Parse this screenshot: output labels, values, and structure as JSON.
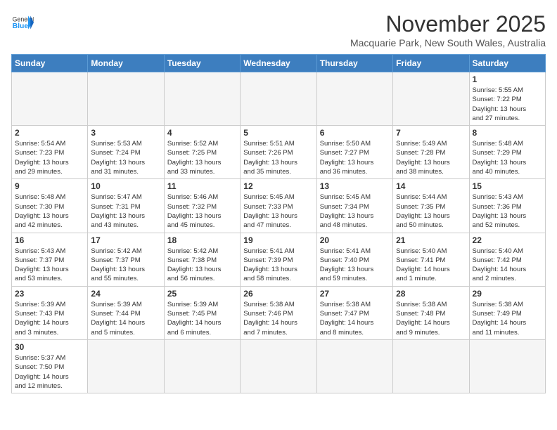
{
  "header": {
    "logo_general": "General",
    "logo_blue": "Blue",
    "month_title": "November 2025",
    "location": "Macquarie Park, New South Wales, Australia"
  },
  "days_of_week": [
    "Sunday",
    "Monday",
    "Tuesday",
    "Wednesday",
    "Thursday",
    "Friday",
    "Saturday"
  ],
  "weeks": [
    [
      {
        "day": "",
        "info": ""
      },
      {
        "day": "",
        "info": ""
      },
      {
        "day": "",
        "info": ""
      },
      {
        "day": "",
        "info": ""
      },
      {
        "day": "",
        "info": ""
      },
      {
        "day": "",
        "info": ""
      },
      {
        "day": "1",
        "info": "Sunrise: 5:55 AM\nSunset: 7:22 PM\nDaylight: 13 hours\nand 27 minutes."
      }
    ],
    [
      {
        "day": "2",
        "info": "Sunrise: 5:54 AM\nSunset: 7:23 PM\nDaylight: 13 hours\nand 29 minutes."
      },
      {
        "day": "3",
        "info": "Sunrise: 5:53 AM\nSunset: 7:24 PM\nDaylight: 13 hours\nand 31 minutes."
      },
      {
        "day": "4",
        "info": "Sunrise: 5:52 AM\nSunset: 7:25 PM\nDaylight: 13 hours\nand 33 minutes."
      },
      {
        "day": "5",
        "info": "Sunrise: 5:51 AM\nSunset: 7:26 PM\nDaylight: 13 hours\nand 35 minutes."
      },
      {
        "day": "6",
        "info": "Sunrise: 5:50 AM\nSunset: 7:27 PM\nDaylight: 13 hours\nand 36 minutes."
      },
      {
        "day": "7",
        "info": "Sunrise: 5:49 AM\nSunset: 7:28 PM\nDaylight: 13 hours\nand 38 minutes."
      },
      {
        "day": "8",
        "info": "Sunrise: 5:48 AM\nSunset: 7:29 PM\nDaylight: 13 hours\nand 40 minutes."
      }
    ],
    [
      {
        "day": "9",
        "info": "Sunrise: 5:48 AM\nSunset: 7:30 PM\nDaylight: 13 hours\nand 42 minutes."
      },
      {
        "day": "10",
        "info": "Sunrise: 5:47 AM\nSunset: 7:31 PM\nDaylight: 13 hours\nand 43 minutes."
      },
      {
        "day": "11",
        "info": "Sunrise: 5:46 AM\nSunset: 7:32 PM\nDaylight: 13 hours\nand 45 minutes."
      },
      {
        "day": "12",
        "info": "Sunrise: 5:45 AM\nSunset: 7:33 PM\nDaylight: 13 hours\nand 47 minutes."
      },
      {
        "day": "13",
        "info": "Sunrise: 5:45 AM\nSunset: 7:34 PM\nDaylight: 13 hours\nand 48 minutes."
      },
      {
        "day": "14",
        "info": "Sunrise: 5:44 AM\nSunset: 7:35 PM\nDaylight: 13 hours\nand 50 minutes."
      },
      {
        "day": "15",
        "info": "Sunrise: 5:43 AM\nSunset: 7:36 PM\nDaylight: 13 hours\nand 52 minutes."
      }
    ],
    [
      {
        "day": "16",
        "info": "Sunrise: 5:43 AM\nSunset: 7:37 PM\nDaylight: 13 hours\nand 53 minutes."
      },
      {
        "day": "17",
        "info": "Sunrise: 5:42 AM\nSunset: 7:37 PM\nDaylight: 13 hours\nand 55 minutes."
      },
      {
        "day": "18",
        "info": "Sunrise: 5:42 AM\nSunset: 7:38 PM\nDaylight: 13 hours\nand 56 minutes."
      },
      {
        "day": "19",
        "info": "Sunrise: 5:41 AM\nSunset: 7:39 PM\nDaylight: 13 hours\nand 58 minutes."
      },
      {
        "day": "20",
        "info": "Sunrise: 5:41 AM\nSunset: 7:40 PM\nDaylight: 13 hours\nand 59 minutes."
      },
      {
        "day": "21",
        "info": "Sunrise: 5:40 AM\nSunset: 7:41 PM\nDaylight: 14 hours\nand 1 minute."
      },
      {
        "day": "22",
        "info": "Sunrise: 5:40 AM\nSunset: 7:42 PM\nDaylight: 14 hours\nand 2 minutes."
      }
    ],
    [
      {
        "day": "23",
        "info": "Sunrise: 5:39 AM\nSunset: 7:43 PM\nDaylight: 14 hours\nand 3 minutes."
      },
      {
        "day": "24",
        "info": "Sunrise: 5:39 AM\nSunset: 7:44 PM\nDaylight: 14 hours\nand 5 minutes."
      },
      {
        "day": "25",
        "info": "Sunrise: 5:39 AM\nSunset: 7:45 PM\nDaylight: 14 hours\nand 6 minutes."
      },
      {
        "day": "26",
        "info": "Sunrise: 5:38 AM\nSunset: 7:46 PM\nDaylight: 14 hours\nand 7 minutes."
      },
      {
        "day": "27",
        "info": "Sunrise: 5:38 AM\nSunset: 7:47 PM\nDaylight: 14 hours\nand 8 minutes."
      },
      {
        "day": "28",
        "info": "Sunrise: 5:38 AM\nSunset: 7:48 PM\nDaylight: 14 hours\nand 9 minutes."
      },
      {
        "day": "29",
        "info": "Sunrise: 5:38 AM\nSunset: 7:49 PM\nDaylight: 14 hours\nand 11 minutes."
      }
    ],
    [
      {
        "day": "30",
        "info": "Sunrise: 5:37 AM\nSunset: 7:50 PM\nDaylight: 14 hours\nand 12 minutes."
      },
      {
        "day": "",
        "info": ""
      },
      {
        "day": "",
        "info": ""
      },
      {
        "day": "",
        "info": ""
      },
      {
        "day": "",
        "info": ""
      },
      {
        "day": "",
        "info": ""
      },
      {
        "day": "",
        "info": ""
      }
    ]
  ]
}
